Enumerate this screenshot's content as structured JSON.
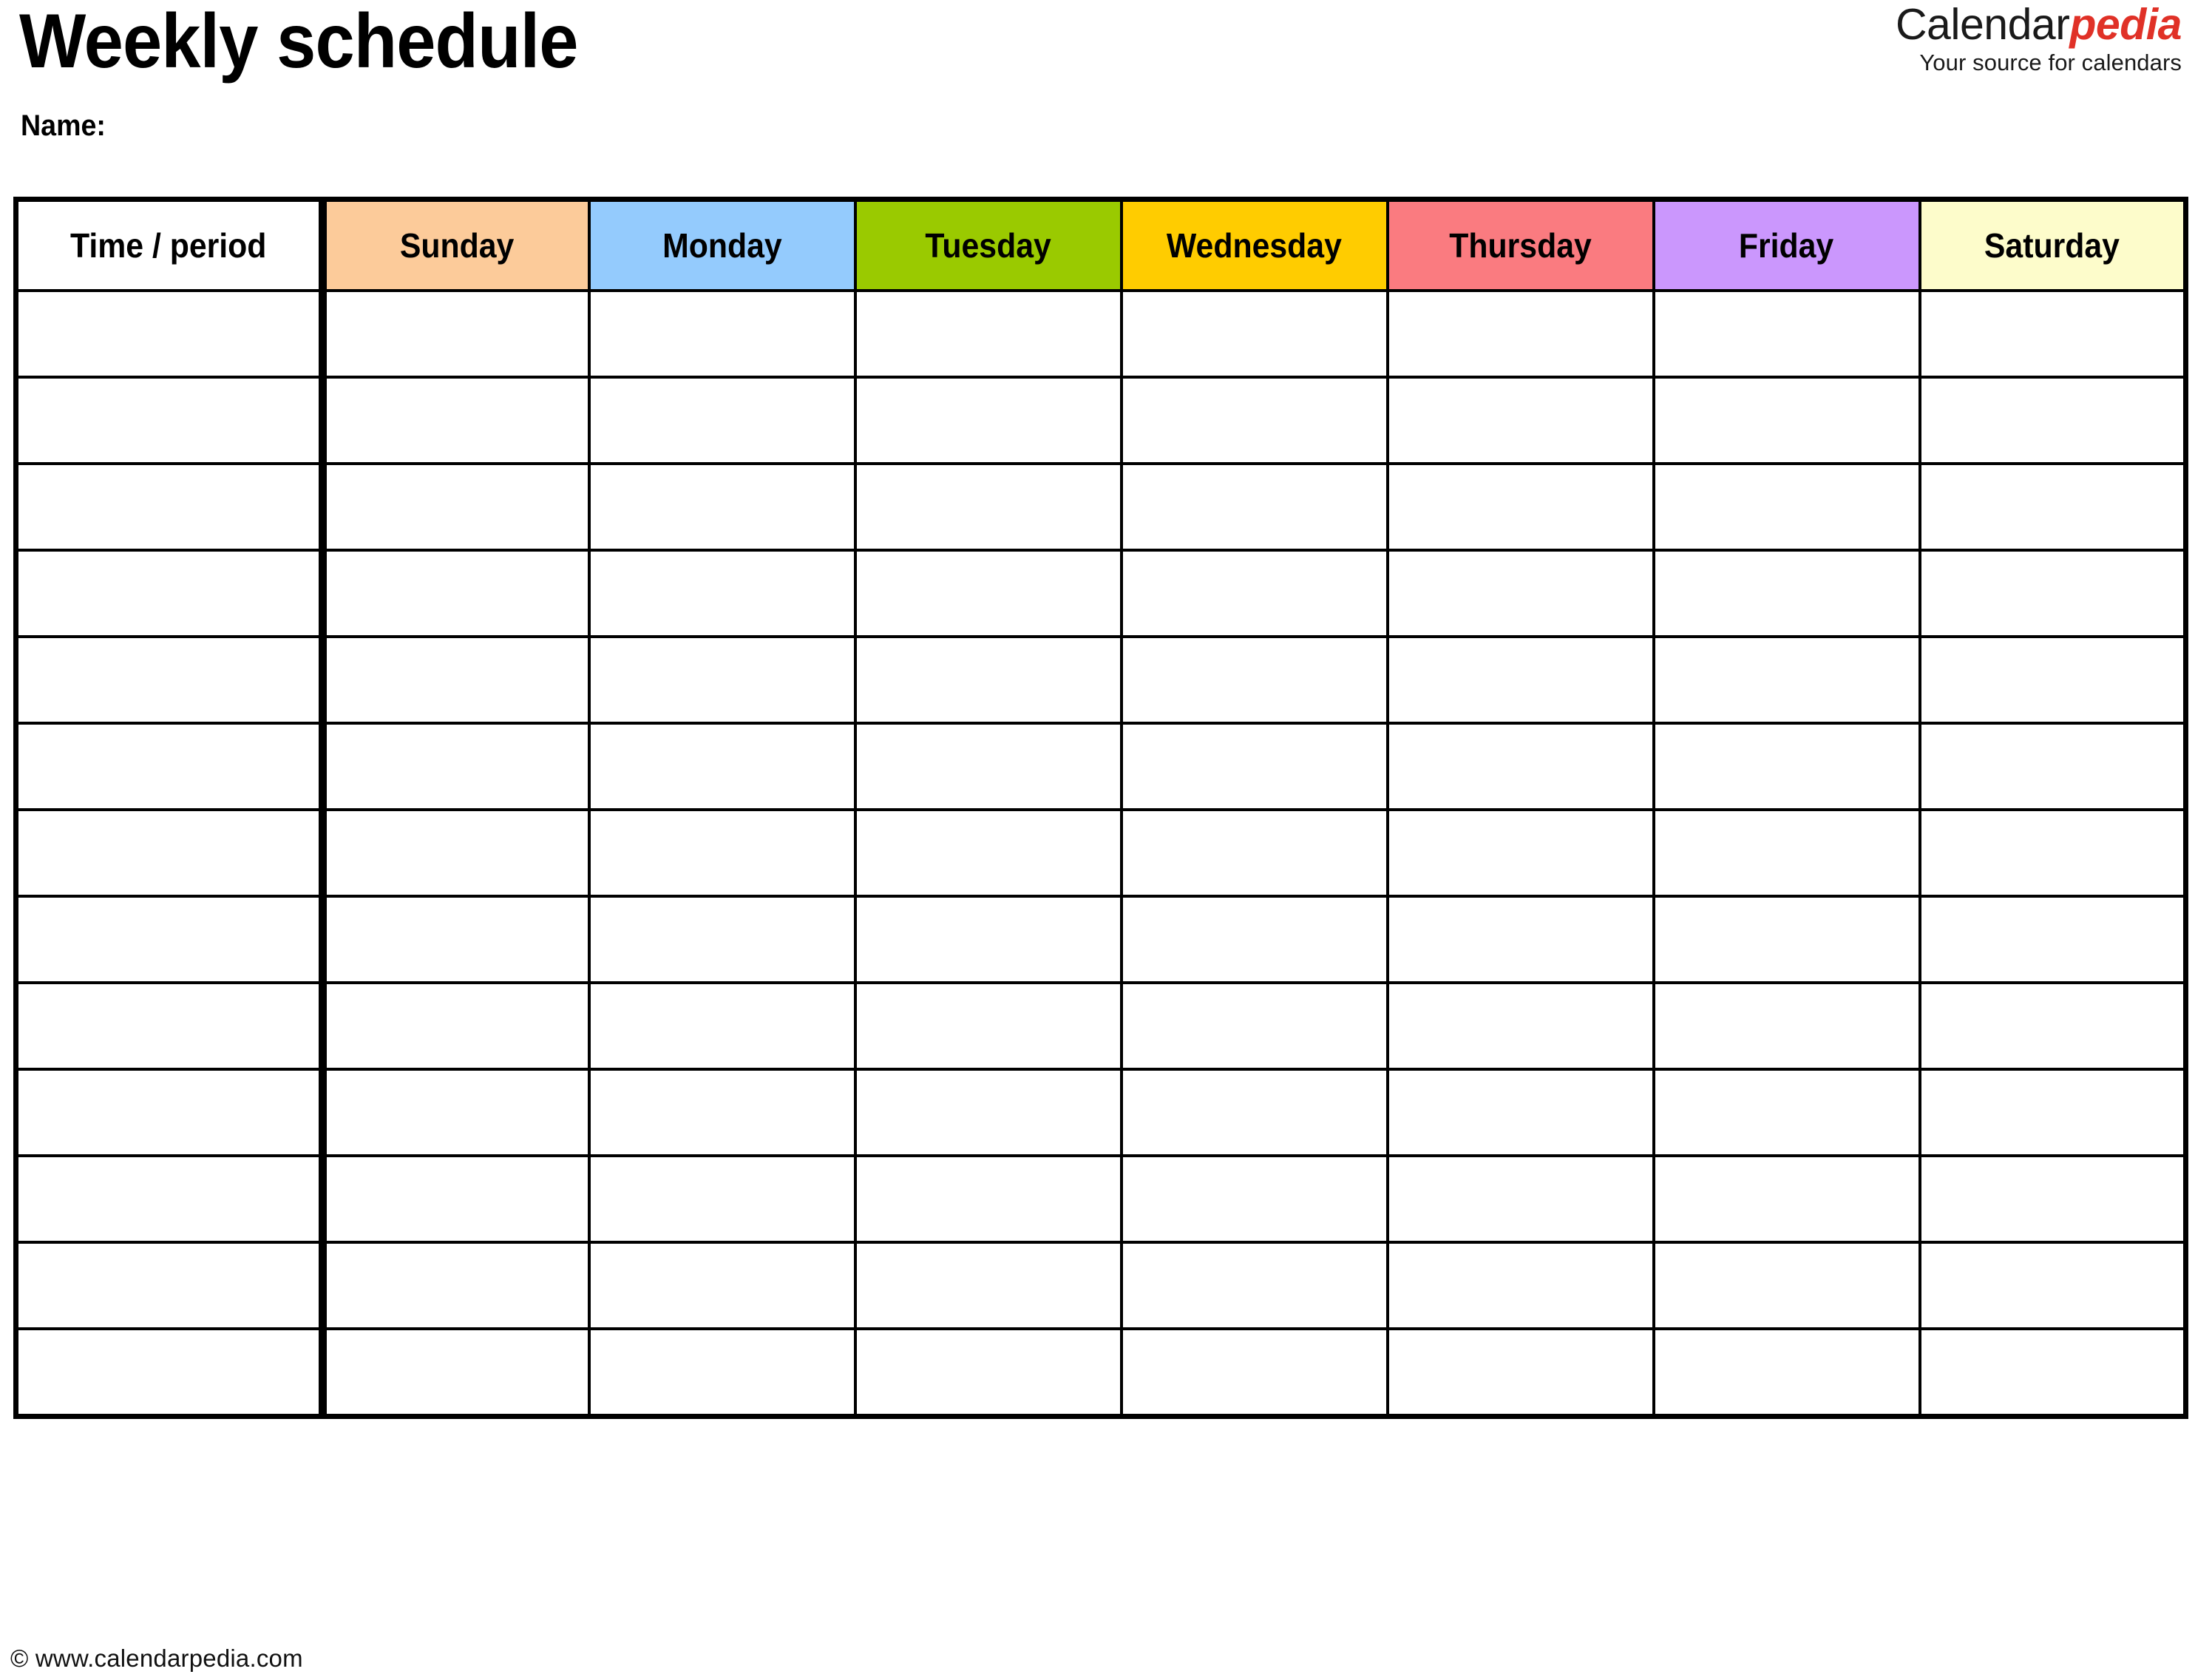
{
  "document": {
    "title": "Weekly schedule",
    "name_label": "Name:"
  },
  "brand": {
    "name_primary": "Calendar",
    "name_accent": "pedia",
    "tagline": "Your source for calendars",
    "accent_color": "#E03127",
    "primary_color": "#1a1a1a"
  },
  "table": {
    "columns": [
      {
        "label": "Time / period",
        "color": "#FFFFFF",
        "type": "time"
      },
      {
        "label": "Sunday",
        "color": "#FCCB9A",
        "type": "day"
      },
      {
        "label": "Monday",
        "color": "#94CBFD",
        "type": "day"
      },
      {
        "label": "Tuesday",
        "color": "#9ACA00",
        "type": "day"
      },
      {
        "label": "Wednesday",
        "color": "#FFCC00",
        "type": "day"
      },
      {
        "label": "Thursday",
        "color": "#FA7B80",
        "type": "day"
      },
      {
        "label": "Friday",
        "color": "#CB97FD",
        "type": "day"
      },
      {
        "label": "Saturday",
        "color": "#FDFCCB",
        "type": "day"
      }
    ],
    "row_count": 13,
    "rows": [
      [
        "",
        "",
        "",
        "",
        "",
        "",
        "",
        ""
      ],
      [
        "",
        "",
        "",
        "",
        "",
        "",
        "",
        ""
      ],
      [
        "",
        "",
        "",
        "",
        "",
        "",
        "",
        ""
      ],
      [
        "",
        "",
        "",
        "",
        "",
        "",
        "",
        ""
      ],
      [
        "",
        "",
        "",
        "",
        "",
        "",
        "",
        ""
      ],
      [
        "",
        "",
        "",
        "",
        "",
        "",
        "",
        ""
      ],
      [
        "",
        "",
        "",
        "",
        "",
        "",
        "",
        ""
      ],
      [
        "",
        "",
        "",
        "",
        "",
        "",
        "",
        ""
      ],
      [
        "",
        "",
        "",
        "",
        "",
        "",
        "",
        ""
      ],
      [
        "",
        "",
        "",
        "",
        "",
        "",
        "",
        ""
      ],
      [
        "",
        "",
        "",
        "",
        "",
        "",
        "",
        ""
      ],
      [
        "",
        "",
        "",
        "",
        "",
        "",
        "",
        ""
      ],
      [
        "",
        "",
        "",
        "",
        "",
        "",
        "",
        ""
      ]
    ],
    "border_color": "#000000"
  },
  "footer": {
    "copyright": "© www.calendarpedia.com"
  }
}
